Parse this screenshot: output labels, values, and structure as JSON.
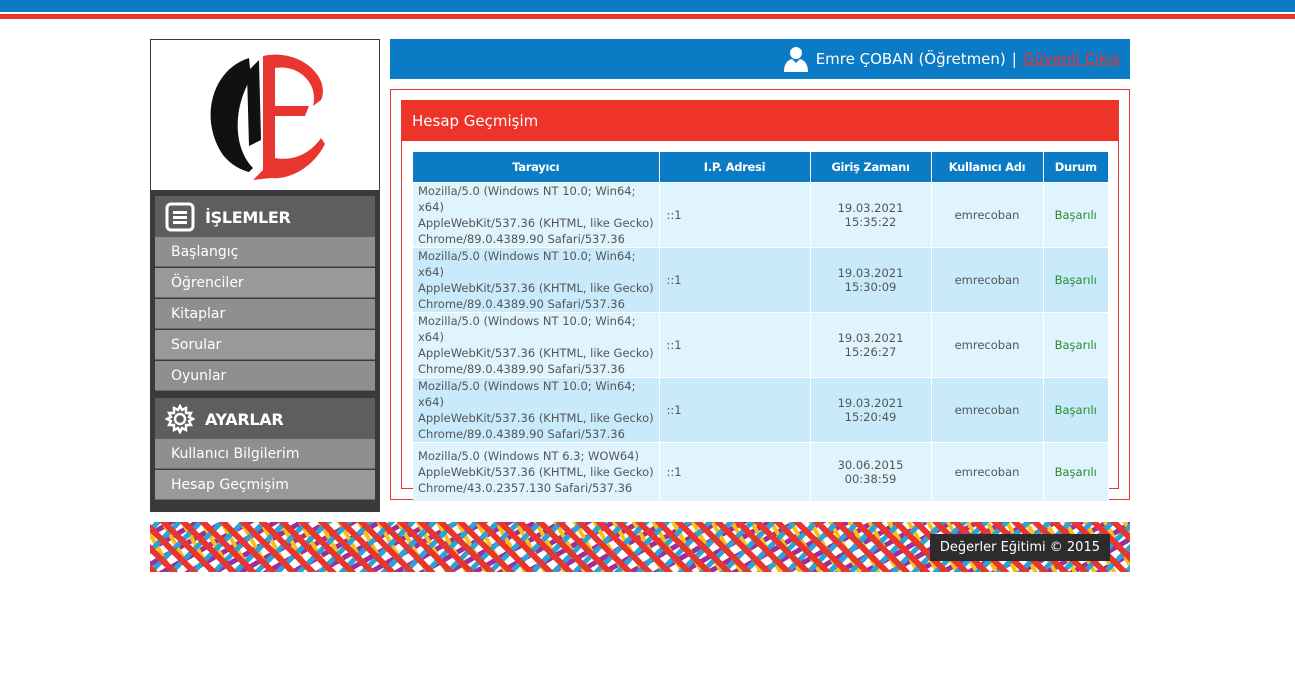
{
  "header": {
    "user_name": "Emre ÇOBAN (Öğretmen)",
    "separator": "|",
    "logout_label": "Güvenli Çıkış"
  },
  "sidebar": {
    "section1": {
      "title": "İŞLEMLER",
      "icon": "list-icon"
    },
    "section1_items": [
      "Başlangıç",
      "Öğrenciler",
      "Kitaplar",
      "Sorular",
      "Oyunlar"
    ],
    "section2": {
      "title": "AYARLAR",
      "icon": "gear-icon"
    },
    "section2_items": [
      "Kullanıcı Bilgilerim",
      "Hesap Geçmişim"
    ]
  },
  "panel": {
    "title": "Hesap Geçmişim",
    "columns": [
      "Tarayıcı",
      "I.P. Adresi",
      "Giriş Zamanı",
      "Kullanıcı Adı",
      "Durum"
    ],
    "rows": [
      {
        "browser": [
          "Mozilla/5.0 (Windows NT 10.0; Win64; x64)",
          "AppleWebKit/537.36 (KHTML, like Gecko)",
          "Chrome/89.0.4389.90 Safari/537.36"
        ],
        "ip": "::1",
        "time": "19.03.2021 15:35:22",
        "user": "emrecoban",
        "status": "Başarılı"
      },
      {
        "browser": [
          "Mozilla/5.0 (Windows NT 10.0; Win64; x64)",
          "AppleWebKit/537.36 (KHTML, like Gecko)",
          "Chrome/89.0.4389.90 Safari/537.36"
        ],
        "ip": "::1",
        "time": "19.03.2021 15:30:09",
        "user": "emrecoban",
        "status": "Başarılı"
      },
      {
        "browser": [
          "Mozilla/5.0 (Windows NT 10.0; Win64; x64)",
          "AppleWebKit/537.36 (KHTML, like Gecko)",
          "Chrome/89.0.4389.90 Safari/537.36"
        ],
        "ip": "::1",
        "time": "19.03.2021 15:26:27",
        "user": "emrecoban",
        "status": "Başarılı"
      },
      {
        "browser": [
          "Mozilla/5.0 (Windows NT 10.0; Win64; x64)",
          "AppleWebKit/537.36 (KHTML, like Gecko)",
          "Chrome/89.0.4389.90 Safari/537.36"
        ],
        "ip": "::1",
        "time": "19.03.2021 15:20:49",
        "user": "emrecoban",
        "status": "Başarılı"
      },
      {
        "browser": [
          "Mozilla/5.0 (Windows NT 6.3; WOW64)",
          "AppleWebKit/537.36 (KHTML, like Gecko)",
          "Chrome/43.0.2357.130 Safari/537.36"
        ],
        "ip": "::1",
        "time": "30.06.2015 00:38:59",
        "user": "emrecoban",
        "status": "Başarılı"
      }
    ]
  },
  "footer": {
    "copyright": "Değerler Eğitimi © 2015"
  },
  "colors": {
    "brand_blue": "#0a7bc4",
    "brand_red": "#e8362e",
    "success_green": "#2a8a2a"
  }
}
